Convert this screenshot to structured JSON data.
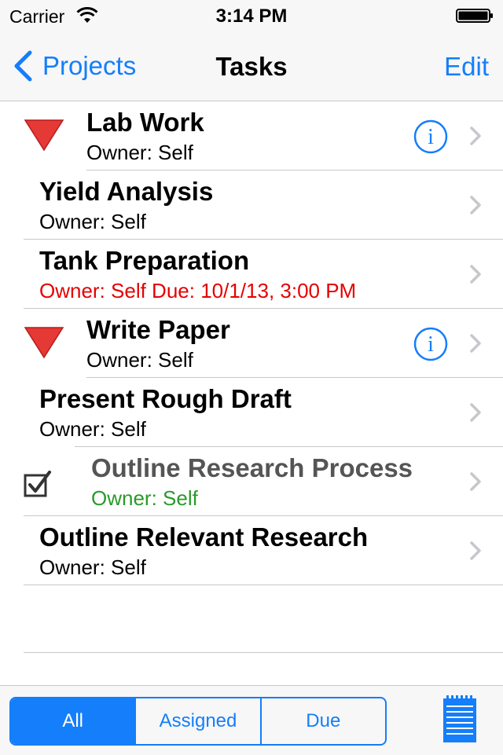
{
  "status_bar": {
    "carrier": "Carrier",
    "time": "3:14 PM"
  },
  "nav": {
    "back_label": "Projects",
    "title": "Tasks",
    "edit_label": "Edit"
  },
  "tasks": [
    {
      "title": "Lab Work",
      "owner": "Owner: Self",
      "icon": "red-triangle-icon",
      "info": true
    },
    {
      "title": "Yield Analysis",
      "owner": "Owner: Self"
    },
    {
      "title": "Tank Preparation",
      "owner": "Owner: Self Due: 10/1/13, 3:00 PM",
      "owner_color": "#e60000"
    },
    {
      "title": "Write Paper",
      "owner": "Owner: Self",
      "icon": "red-triangle-icon",
      "info": true
    },
    {
      "title": "Present Rough Draft",
      "owner": "Owner: Self"
    },
    {
      "title": "Outline Research Process",
      "owner": "Owner: Self",
      "icon": "checkbox-checked-icon",
      "completed": true,
      "title_color": "#555555",
      "owner_color": "#2a9a2a"
    },
    {
      "title": "Outline Relevant Research",
      "owner": "Owner: Self"
    }
  ],
  "filter": {
    "options": [
      "All",
      "Assigned",
      "Due"
    ],
    "selected": "All"
  },
  "colors": {
    "accent": "#147efb",
    "triangle": "#e53935",
    "overdue": "#e60000",
    "completed": "#2a9a2a"
  }
}
